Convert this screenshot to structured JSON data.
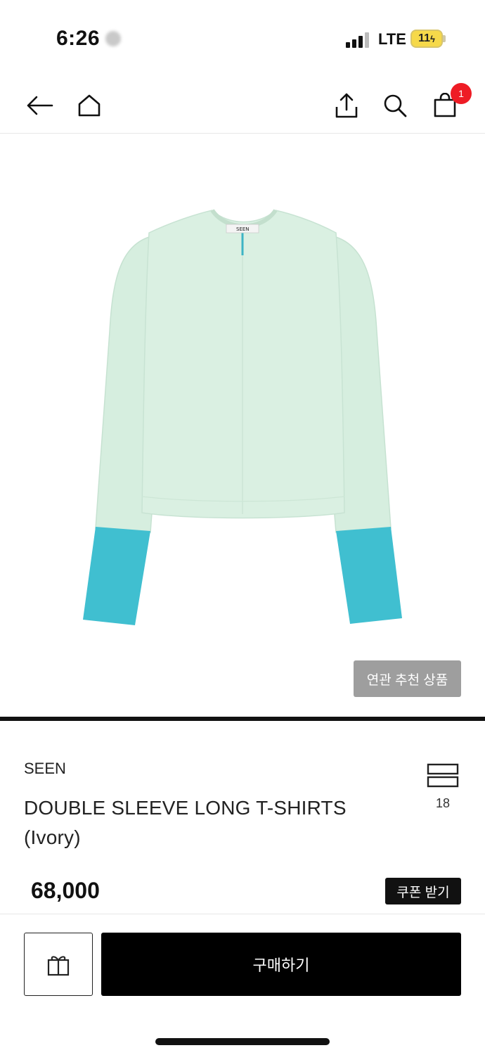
{
  "status_bar": {
    "time": "6:26",
    "network": "LTE",
    "battery": "11"
  },
  "nav": {
    "cart_count": "1",
    "icons": [
      "back-arrow-icon",
      "home-icon",
      "share-icon",
      "search-icon",
      "shopping-bag-icon"
    ]
  },
  "product": {
    "image_label": "SEEN",
    "related_button": "연관 추천 상품",
    "brand": "SEEN",
    "title": "DOUBLE SLEEVE LONG T-SHIRTS (Ivory)",
    "like_count": "18",
    "price": "68,000",
    "coupon_button": "쿠폰 받기"
  },
  "actions": {
    "buy_button": "구매하기",
    "gift_icon": "gift-icon"
  },
  "colors": {
    "shirt_body": "#d8efe0",
    "shirt_sleeve": "#3fbfcf",
    "badge": "#ee1c25",
    "buy_button": "#000000",
    "related_button": "#9e9e9e"
  }
}
